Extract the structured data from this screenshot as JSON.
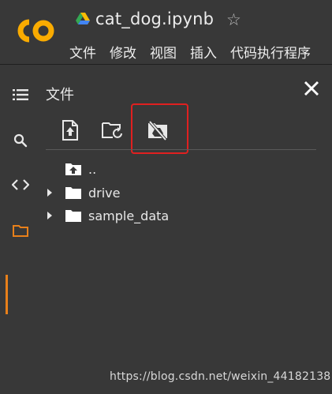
{
  "header": {
    "logo_text": "CO",
    "notebook_title": "cat_dog.ipynb",
    "star_glyph": "☆",
    "menu": [
      "文件",
      "修改",
      "视图",
      "插入",
      "代码执行程序"
    ]
  },
  "sidebar": {
    "icons": [
      "table-of-contents-icon",
      "search-icon",
      "code-snippets-icon",
      "files-icon"
    ],
    "active": "files-icon"
  },
  "files_panel": {
    "title": "文件",
    "toolbar": [
      "upload-icon",
      "refresh-folder-icon",
      "mount-drive-icon"
    ],
    "tree": [
      {
        "label": "..",
        "icon": "folder-up-icon",
        "expandable": false
      },
      {
        "label": "drive",
        "icon": "folder-icon",
        "expandable": true
      },
      {
        "label": "sample_data",
        "icon": "folder-icon",
        "expandable": true
      }
    ]
  },
  "watermark": "https://blog.csdn.net/weixin_44182138",
  "colors": {
    "background": "#383838",
    "accent": "#e8801a",
    "highlight": "#e02020",
    "logo": "#f9ab00"
  }
}
